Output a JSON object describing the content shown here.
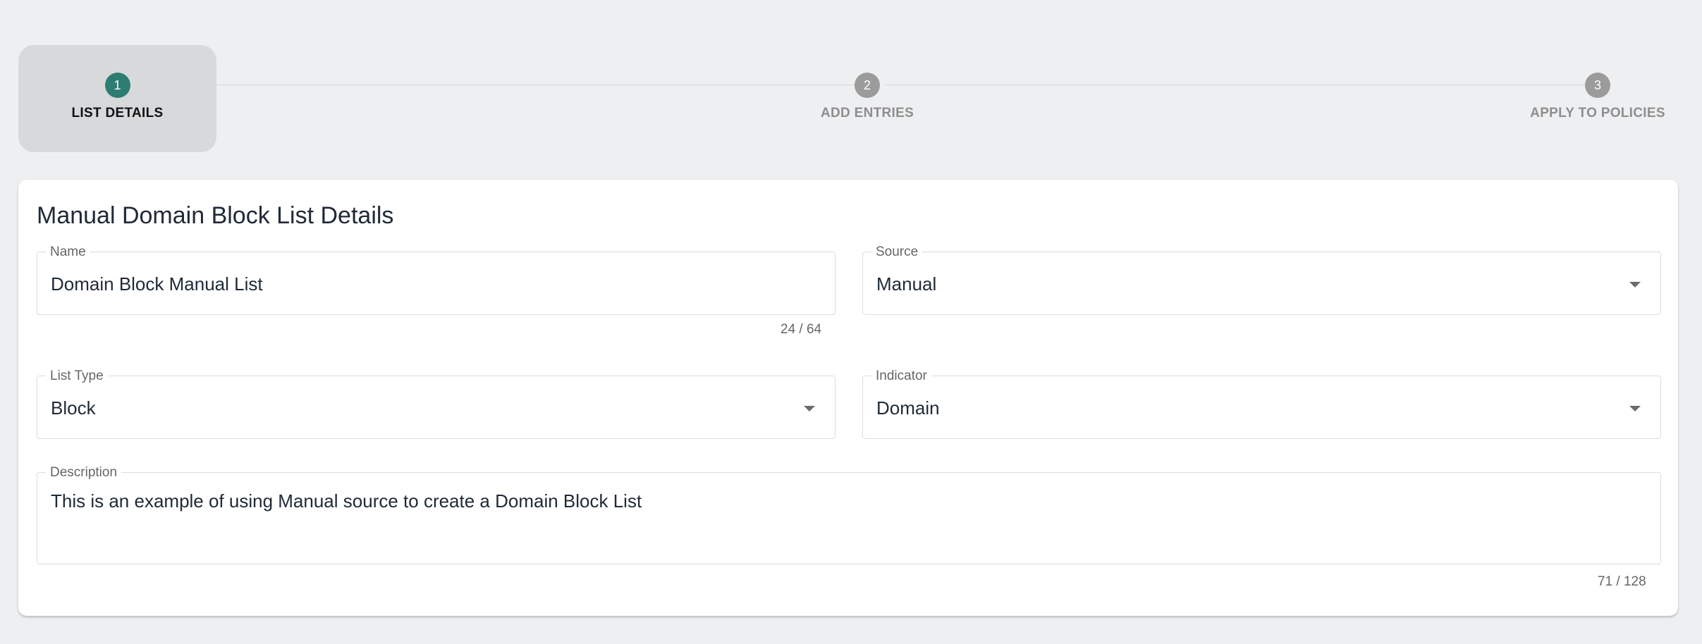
{
  "stepper": {
    "steps": [
      {
        "number": "1",
        "label": "LIST DETAILS",
        "active": true
      },
      {
        "number": "2",
        "label": "ADD ENTRIES",
        "active": false
      },
      {
        "number": "3",
        "label": "APPLY TO POLICIES",
        "active": false
      }
    ]
  },
  "colors": {
    "accent": "#2e7d72",
    "inactive_step": "#9b9b9b",
    "background": "#eeeff1"
  },
  "form": {
    "title": "Manual Domain Block List Details",
    "name": {
      "label": "Name",
      "value": "Domain Block Manual List",
      "counter": "24 / 64"
    },
    "source": {
      "label": "Source",
      "value": "Manual",
      "icon": "chevron-down-icon"
    },
    "list_type": {
      "label": "List Type",
      "value": "Block",
      "icon": "chevron-down-icon"
    },
    "indicator": {
      "label": "Indicator",
      "value": "Domain",
      "icon": "chevron-down-icon"
    },
    "description": {
      "label": "Description",
      "value": "This is an example of using Manual source to create a Domain Block List",
      "counter": "71 / 128"
    }
  }
}
